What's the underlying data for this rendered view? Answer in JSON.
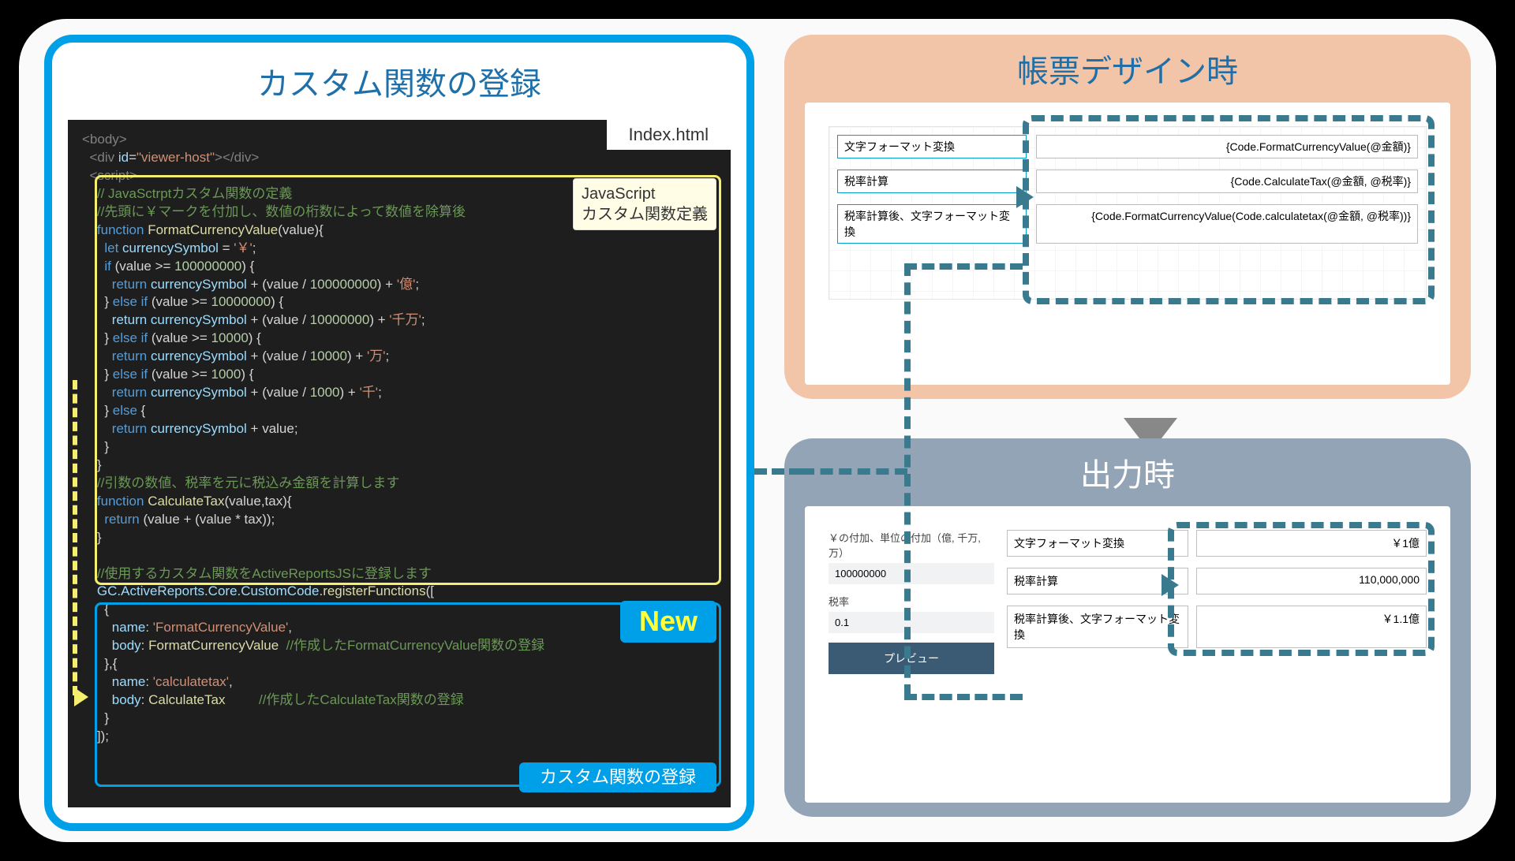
{
  "left": {
    "title": "カスタム関数の登録",
    "filename": "Index.html",
    "callout_js": "JavaScript\nカスタム関数定義",
    "callout_new": "New",
    "callout_reg": "カスタム関数の登録",
    "code": {
      "body_open": "<body>",
      "div": "  <div id=\"viewer-host\"></div>",
      "script_open": "  <script>",
      "c1": "    // JavaSctrptカスタム関数の定義",
      "c2": "    //先頭に￥マークを付加し、数値の桁数によって数値を除算後",
      "fn1": "    function FormatCurrencyValue(value){",
      "l1": "      let currencySymbol = '￥';",
      "l2": "      if (value >= 100000000) {",
      "l3": "        return currencySymbol + (value / 100000000) + '億';",
      "l4": "      } else if (value >= 10000000) {",
      "l5": "        return currencySymbol + (value / 10000000) + '千万';",
      "l6": "      } else if (value >= 10000) {",
      "l7": "        return currencySymbol + (value / 10000) + '万';",
      "l8": "      } else if (value >= 1000) {",
      "l9": "        return currencySymbol + (value / 1000) + '千';",
      "l10": "      } else {",
      "l11": "        return currencySymbol + value;",
      "l12": "      }",
      "l13": "    }",
      "c3": "    //引数の数値、税率を元に税込み金額を計算します",
      "fn2": "    function CalculateTax(value,tax){",
      "l14": "      return (value + (value * tax));",
      "l15": "    }",
      "c4": "    //使用するカスタム関数をActiveReportsJSに登録します",
      "reg1": "    GC.ActiveReports.Core.CustomCode.registerFunctions([",
      "reg2": "      {",
      "reg3": "        name: 'FormatCurrencyValue',",
      "reg4": "        body: FormatCurrencyValue  //作成したFormatCurrencyValue関数の登録",
      "reg5": "      },{",
      "reg6": "        name: 'calculatetax',",
      "reg7": "        body: CalculateTax         //作成したCalculateTax関数の登録",
      "reg8": "      }",
      "reg9": "    ]);"
    }
  },
  "design": {
    "title": "帳票デザイン時",
    "rows": [
      {
        "label": "文字フォーマット変換",
        "expr": "{Code.FormatCurrencyValue(@金額)}"
      },
      {
        "label": "税率計算",
        "expr": "{Code.CalculateTax(@金額, @税率)}"
      },
      {
        "label": "税率計算後、文字フォーマット変換",
        "expr": "{Code.FormatCurrencyValue(Code.calculatetax(@金額, @税率))}"
      }
    ]
  },
  "output": {
    "title": "出力時",
    "side": {
      "param1_label": "￥の付加、単位の付加（億, 千万, 万）",
      "param1_value": "100000000",
      "param2_label": "税率",
      "param2_value": "0.1",
      "preview_btn": "プレビュー"
    },
    "rows": [
      {
        "label": "文字フォーマット変換",
        "val": "￥1億"
      },
      {
        "label": "税率計算",
        "val": "110,000,000"
      },
      {
        "label": "税率計算後、文字フォーマット変換",
        "val": "￥1.1億"
      }
    ]
  }
}
